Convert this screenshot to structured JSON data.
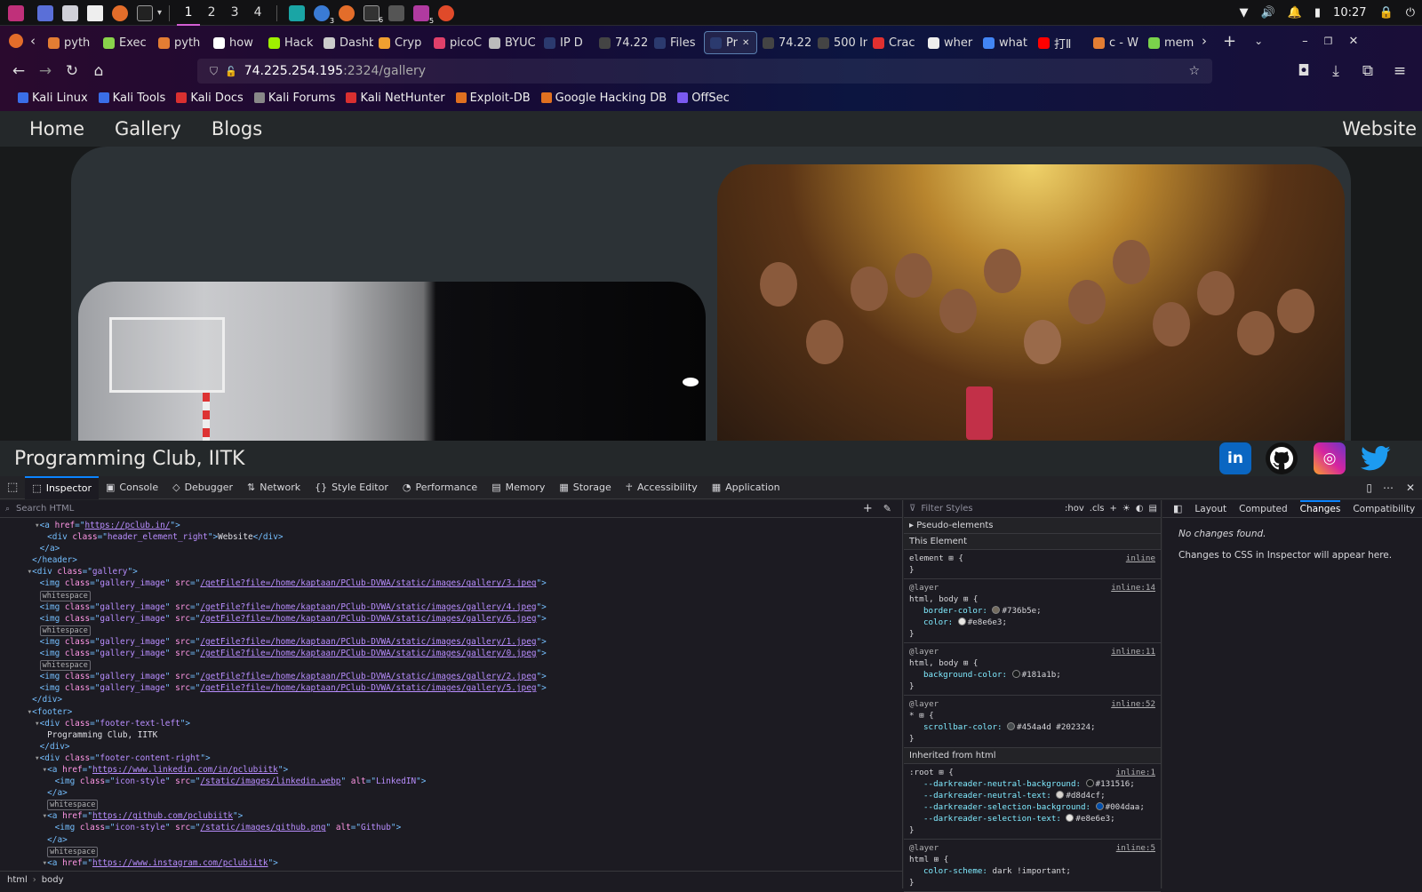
{
  "taskbar": {
    "workspaces": [
      "1",
      "2",
      "3",
      "4"
    ],
    "active_workspace": "1",
    "badges": [
      "3",
      "6",
      "5"
    ],
    "clock": "10:27"
  },
  "browser": {
    "tabs": [
      {
        "label": "pyth",
        "color": "#e37d33"
      },
      {
        "label": "Exec",
        "color": "#89d34b"
      },
      {
        "label": "pyth",
        "color": "#e37d33"
      },
      {
        "label": "how",
        "color": "#ffffff"
      },
      {
        "label": "Hack",
        "color": "#9fef00"
      },
      {
        "label": "Dashbo",
        "color": "#cccccc"
      },
      {
        "label": "Cryp",
        "color": "#f0a030"
      },
      {
        "label": "picoC",
        "color": "#e0406a"
      },
      {
        "label": "BYUC",
        "color": "#bbbbbb"
      },
      {
        "label": "IP D",
        "color": "#2b3a6e"
      },
      {
        "label": "74.225.2",
        "color": "#444444"
      },
      {
        "label": "Files",
        "color": "#2b3a6e"
      },
      {
        "label": "Pr",
        "color": "#2b3a6e",
        "active": true
      },
      {
        "label": "74.225.2",
        "color": "#444444"
      },
      {
        "label": "500 Inte",
        "color": "#444444"
      },
      {
        "label": "Crac",
        "color": "#e03030"
      },
      {
        "label": "wher",
        "color": "#eeeeee"
      },
      {
        "label": "what",
        "color": "#4285f4"
      },
      {
        "label": "打Ⅱ",
        "color": "#ff0000"
      },
      {
        "label": "c - W",
        "color": "#e37d33"
      },
      {
        "label": "mem",
        "color": "#7ad34b"
      }
    ],
    "url_host": "74.225.254.195",
    "url_rest": ":2324/gallery",
    "bookmarks": [
      {
        "label": "Kali Linux",
        "color": "#3a6ee8"
      },
      {
        "label": "Kali Tools",
        "color": "#3a6ee8"
      },
      {
        "label": "Kali Docs",
        "color": "#d93030"
      },
      {
        "label": "Kali Forums",
        "color": "#888888"
      },
      {
        "label": "Kali NetHunter",
        "color": "#d93030"
      },
      {
        "label": "Exploit-DB",
        "color": "#e07020"
      },
      {
        "label": "Google Hacking DB",
        "color": "#e07020"
      },
      {
        "label": "OffSec",
        "color": "#7a5af0"
      }
    ]
  },
  "site": {
    "nav": {
      "home": "Home",
      "gallery": "Gallery",
      "blogs": "Blogs",
      "website": "Website"
    },
    "footer_text": "Programming Club, IITK",
    "social": [
      {
        "name": "linkedin",
        "glyph": "in",
        "color": "#0a66c2"
      },
      {
        "name": "github",
        "glyph": "",
        "color": "#111111"
      },
      {
        "name": "instagram",
        "glyph": "◎",
        "color": "#d6249f"
      },
      {
        "name": "twitter",
        "glyph": "",
        "color": "#1d9bf0"
      }
    ]
  },
  "devtools": {
    "tabs": [
      "Inspector",
      "Console",
      "Debugger",
      "Network",
      "Style Editor",
      "Performance",
      "Memory",
      "Storage",
      "Accessibility",
      "Application"
    ],
    "search_placeholder": "Search HTML",
    "filter_placeholder": "Filter Styles",
    "filter_buttons": [
      ":hov",
      ".cls"
    ],
    "side_tabs": [
      "Layout",
      "Computed",
      "Changes",
      "Compatibility"
    ],
    "breadcrumb": [
      "html",
      "body"
    ],
    "changes_title": "No changes found.",
    "changes_msg": "Changes to CSS in Inspector will appear here.",
    "html_lines": [
      {
        "indent": 2,
        "tri": "▾",
        "parts": [
          [
            "tg",
            "<a "
          ],
          [
            "at",
            "href"
          ],
          [
            "tg",
            "=\""
          ],
          [
            "lk",
            "https://pclub.in/"
          ],
          [
            "tg",
            "\">"
          ]
        ]
      },
      {
        "indent": 3,
        "parts": [
          [
            "tg",
            "<div "
          ],
          [
            "at",
            "class"
          ],
          [
            "tg",
            "=\""
          ],
          [
            "vl",
            "header_element_right"
          ],
          [
            "tg",
            "\">"
          ],
          [
            "tx",
            "Website"
          ],
          [
            "tg",
            "</div>"
          ]
        ]
      },
      {
        "indent": 2,
        "parts": [
          [
            "tg",
            "</a>"
          ]
        ]
      },
      {
        "indent": 1,
        "parts": [
          [
            "tg",
            "</header>"
          ]
        ]
      },
      {
        "indent": 1,
        "tri": "▾",
        "parts": [
          [
            "tg",
            "<div "
          ],
          [
            "at",
            "class"
          ],
          [
            "tg",
            "=\""
          ],
          [
            "vl",
            "gallery"
          ],
          [
            "tg",
            "\">"
          ]
        ]
      },
      {
        "indent": 2,
        "parts": [
          [
            "tg",
            "<img "
          ],
          [
            "at",
            "class"
          ],
          [
            "tg",
            "=\""
          ],
          [
            "vl",
            "gallery_image"
          ],
          [
            "tg",
            "\" "
          ],
          [
            "at",
            "src"
          ],
          [
            "tg",
            "=\""
          ],
          [
            "lk",
            "/getFile?file=/home/kaptaan/PClub-DVWA/static/images/gallery/3.jpeg"
          ],
          [
            "tg",
            "\">"
          ]
        ]
      },
      {
        "indent": 2,
        "pill": "whitespace"
      },
      {
        "indent": 2,
        "parts": [
          [
            "tg",
            "<img "
          ],
          [
            "at",
            "class"
          ],
          [
            "tg",
            "=\""
          ],
          [
            "vl",
            "gallery_image"
          ],
          [
            "tg",
            "\" "
          ],
          [
            "at",
            "src"
          ],
          [
            "tg",
            "=\""
          ],
          [
            "lk",
            "/getFile?file=/home/kaptaan/PClub-DVWA/static/images/gallery/4.jpeg"
          ],
          [
            "tg",
            "\">"
          ]
        ]
      },
      {
        "indent": 2,
        "parts": [
          [
            "tg",
            "<img "
          ],
          [
            "at",
            "class"
          ],
          [
            "tg",
            "=\""
          ],
          [
            "vl",
            "gallery_image"
          ],
          [
            "tg",
            "\" "
          ],
          [
            "at",
            "src"
          ],
          [
            "tg",
            "=\""
          ],
          [
            "lk",
            "/getFile?file=/home/kaptaan/PClub-DVWA/static/images/gallery/6.jpeg"
          ],
          [
            "tg",
            "\">"
          ]
        ]
      },
      {
        "indent": 2,
        "pill": "whitespace"
      },
      {
        "indent": 2,
        "parts": [
          [
            "tg",
            "<img "
          ],
          [
            "at",
            "class"
          ],
          [
            "tg",
            "=\""
          ],
          [
            "vl",
            "gallery_image"
          ],
          [
            "tg",
            "\" "
          ],
          [
            "at",
            "src"
          ],
          [
            "tg",
            "=\""
          ],
          [
            "lk",
            "/getFile?file=/home/kaptaan/PClub-DVWA/static/images/gallery/1.jpeg"
          ],
          [
            "tg",
            "\">"
          ]
        ]
      },
      {
        "indent": 2,
        "parts": [
          [
            "tg",
            "<img "
          ],
          [
            "at",
            "class"
          ],
          [
            "tg",
            "=\""
          ],
          [
            "vl",
            "gallery_image"
          ],
          [
            "tg",
            "\" "
          ],
          [
            "at",
            "src"
          ],
          [
            "tg",
            "=\""
          ],
          [
            "lk",
            "/getFile?file=/home/kaptaan/PClub-DVWA/static/images/gallery/0.jpeg"
          ],
          [
            "tg",
            "\">"
          ]
        ]
      },
      {
        "indent": 2,
        "pill": "whitespace"
      },
      {
        "indent": 2,
        "parts": [
          [
            "tg",
            "<img "
          ],
          [
            "at",
            "class"
          ],
          [
            "tg",
            "=\""
          ],
          [
            "vl",
            "gallery_image"
          ],
          [
            "tg",
            "\" "
          ],
          [
            "at",
            "src"
          ],
          [
            "tg",
            "=\""
          ],
          [
            "lk",
            "/getFile?file=/home/kaptaan/PClub-DVWA/static/images/gallery/2.jpeg"
          ],
          [
            "tg",
            "\">"
          ]
        ]
      },
      {
        "indent": 2,
        "parts": [
          [
            "tg",
            "<img "
          ],
          [
            "at",
            "class"
          ],
          [
            "tg",
            "=\""
          ],
          [
            "vl",
            "gallery_image"
          ],
          [
            "tg",
            "\" "
          ],
          [
            "at",
            "src"
          ],
          [
            "tg",
            "=\""
          ],
          [
            "lk",
            "/getFile?file=/home/kaptaan/PClub-DVWA/static/images/gallery/5.jpeg"
          ],
          [
            "tg",
            "\">"
          ]
        ]
      },
      {
        "indent": 1,
        "parts": [
          [
            "tg",
            "</div>"
          ]
        ]
      },
      {
        "indent": 1,
        "tri": "▾",
        "parts": [
          [
            "tg",
            "<footer>"
          ]
        ]
      },
      {
        "indent": 2,
        "tri": "▾",
        "parts": [
          [
            "tg",
            "<div "
          ],
          [
            "at",
            "class"
          ],
          [
            "tg",
            "=\""
          ],
          [
            "vl",
            "footer-text-left"
          ],
          [
            "tg",
            "\">"
          ]
        ]
      },
      {
        "indent": 3,
        "parts": [
          [
            "tx",
            "Programming Club, IITK"
          ]
        ]
      },
      {
        "indent": 2,
        "parts": [
          [
            "tg",
            "</div>"
          ]
        ]
      },
      {
        "indent": 2,
        "tri": "▾",
        "parts": [
          [
            "tg",
            "<div "
          ],
          [
            "at",
            "class"
          ],
          [
            "tg",
            "=\""
          ],
          [
            "vl",
            "footer-content-right"
          ],
          [
            "tg",
            "\">"
          ]
        ]
      },
      {
        "indent": 3,
        "tri": "▾",
        "parts": [
          [
            "tg",
            "<a "
          ],
          [
            "at",
            "href"
          ],
          [
            "tg",
            "=\""
          ],
          [
            "lk",
            "https://www.linkedin.com/in/pclubiitk"
          ],
          [
            "tg",
            "\">"
          ]
        ]
      },
      {
        "indent": 4,
        "parts": [
          [
            "tg",
            "<img "
          ],
          [
            "at",
            "class"
          ],
          [
            "tg",
            "=\""
          ],
          [
            "vl",
            "icon-style"
          ],
          [
            "tg",
            "\" "
          ],
          [
            "at",
            "src"
          ],
          [
            "tg",
            "=\""
          ],
          [
            "lk",
            "/static/images/linkedin.webp"
          ],
          [
            "tg",
            "\" "
          ],
          [
            "at",
            "alt"
          ],
          [
            "tg",
            "=\""
          ],
          [
            "vl",
            "LinkedIN"
          ],
          [
            "tg",
            "\">"
          ]
        ]
      },
      {
        "indent": 3,
        "parts": [
          [
            "tg",
            "</a>"
          ]
        ]
      },
      {
        "indent": 3,
        "pill": "whitespace"
      },
      {
        "indent": 3,
        "tri": "▾",
        "parts": [
          [
            "tg",
            "<a "
          ],
          [
            "at",
            "href"
          ],
          [
            "tg",
            "=\""
          ],
          [
            "lk",
            "https://github.com/pclubiitk"
          ],
          [
            "tg",
            "\">"
          ]
        ]
      },
      {
        "indent": 4,
        "parts": [
          [
            "tg",
            "<img "
          ],
          [
            "at",
            "class"
          ],
          [
            "tg",
            "=\""
          ],
          [
            "vl",
            "icon-style"
          ],
          [
            "tg",
            "\" "
          ],
          [
            "at",
            "src"
          ],
          [
            "tg",
            "=\""
          ],
          [
            "lk",
            "/static/images/github.png"
          ],
          [
            "tg",
            "\" "
          ],
          [
            "at",
            "alt"
          ],
          [
            "tg",
            "=\""
          ],
          [
            "vl",
            "Github"
          ],
          [
            "tg",
            "\">"
          ]
        ]
      },
      {
        "indent": 3,
        "parts": [
          [
            "tg",
            "</a>"
          ]
        ]
      },
      {
        "indent": 3,
        "pill": "whitespace"
      },
      {
        "indent": 3,
        "tri": "▾",
        "parts": [
          [
            "tg",
            "<a "
          ],
          [
            "at",
            "href"
          ],
          [
            "tg",
            "=\""
          ],
          [
            "lk",
            "https://www.instagram.com/pclubiitk"
          ],
          [
            "tg",
            "\">"
          ]
        ]
      }
    ],
    "styles": {
      "pseudo": "Pseudo-elements",
      "this_element": "This Element",
      "inherited": "Inherited from html",
      "rules": [
        {
          "at": "",
          "sel": "element ⊞ {",
          "src": "inline",
          "props": []
        },
        {
          "at": "@layer",
          "sel": "html, body ⊞ {",
          "src": "inline:14",
          "props": [
            {
              "p": "border-color",
              "v": "#736b5e",
              "sw": "#736b5e"
            },
            {
              "p": "color",
              "v": "#e8e6e3",
              "sw": "#e8e6e3"
            }
          ]
        },
        {
          "at": "@layer",
          "sel": "html, body ⊞ {",
          "src": "inline:11",
          "props": [
            {
              "p": "background-color",
              "v": "#181a1b",
              "sw": "#181a1b"
            }
          ]
        },
        {
          "at": "@layer",
          "sel": "* ⊞ {",
          "src": "inline:52",
          "props": [
            {
              "p": "scrollbar-color",
              "v": "#454a4d  #202324",
              "sw": "#454a4d"
            }
          ]
        },
        {
          "at": "",
          "sel": ":root ⊞ {",
          "src": "inline:1",
          "inherited": true,
          "props": [
            {
              "p": "--darkreader-neutral-background",
              "v": "#131516",
              "sw": "#131516"
            },
            {
              "p": "--darkreader-neutral-text",
              "v": "#d8d4cf",
              "sw": "#d8d4cf"
            },
            {
              "p": "--darkreader-selection-background",
              "v": "#004daa",
              "sw": "#004daa"
            },
            {
              "p": "--darkreader-selection-text",
              "v": "#e8e6e3",
              "sw": "#e8e6e3"
            }
          ]
        },
        {
          "at": "@layer",
          "sel": "html ⊞ {",
          "src": "inline:5",
          "props": [
            {
              "p": "color-scheme",
              "v": "dark !important"
            }
          ]
        }
      ]
    }
  }
}
